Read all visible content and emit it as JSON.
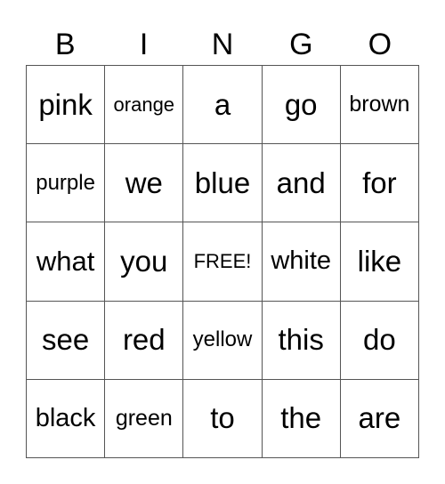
{
  "header": [
    "B",
    "I",
    "N",
    "G",
    "O"
  ],
  "rows": [
    [
      "pink",
      "orange",
      "a",
      "go",
      "brown"
    ],
    [
      "purple",
      "we",
      "blue",
      "and",
      "for"
    ],
    [
      "what",
      "you",
      "FREE!",
      "white",
      "like"
    ],
    [
      "see",
      "red",
      "yellow",
      "this",
      "do"
    ],
    [
      "black",
      "green",
      "to",
      "the",
      "are"
    ]
  ]
}
